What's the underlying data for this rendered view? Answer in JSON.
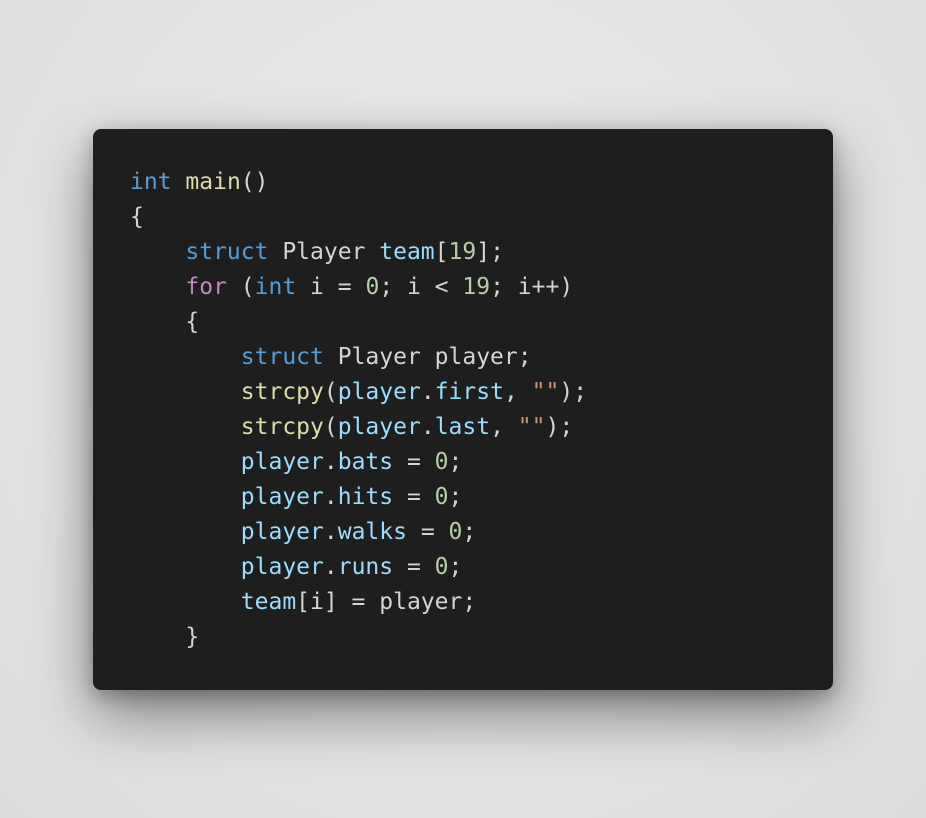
{
  "theme": {
    "background": "#e4e4e4",
    "editor_background": "#1e1e1e",
    "colors": {
      "default": "#d4d4d4",
      "keyword": "#569cd6",
      "control": "#c586c0",
      "function": "#dcdcaa",
      "variable": "#9cdcfe",
      "number": "#b5cea8",
      "string": "#ce9178"
    }
  },
  "code": {
    "language": "c",
    "lines": [
      [
        {
          "t": "int",
          "c": "keyword"
        },
        {
          "t": " ",
          "c": "default"
        },
        {
          "t": "main",
          "c": "function"
        },
        {
          "t": "()",
          "c": "default"
        }
      ],
      [
        {
          "t": "{",
          "c": "default"
        }
      ],
      [
        {
          "t": "    ",
          "c": "default"
        },
        {
          "t": "struct",
          "c": "keyword"
        },
        {
          "t": " Player ",
          "c": "default"
        },
        {
          "t": "team",
          "c": "variable"
        },
        {
          "t": "[",
          "c": "default"
        },
        {
          "t": "19",
          "c": "number"
        },
        {
          "t": "];",
          "c": "default"
        }
      ],
      [
        {
          "t": "    ",
          "c": "default"
        },
        {
          "t": "for",
          "c": "control"
        },
        {
          "t": " (",
          "c": "default"
        },
        {
          "t": "int",
          "c": "keyword"
        },
        {
          "t": " i = ",
          "c": "default"
        },
        {
          "t": "0",
          "c": "number"
        },
        {
          "t": "; i < ",
          "c": "default"
        },
        {
          "t": "19",
          "c": "number"
        },
        {
          "t": "; i++)",
          "c": "default"
        }
      ],
      [
        {
          "t": "    {",
          "c": "default"
        }
      ],
      [
        {
          "t": "        ",
          "c": "default"
        },
        {
          "t": "struct",
          "c": "keyword"
        },
        {
          "t": " Player player;",
          "c": "default"
        }
      ],
      [
        {
          "t": "        ",
          "c": "default"
        },
        {
          "t": "strcpy",
          "c": "function"
        },
        {
          "t": "(",
          "c": "default"
        },
        {
          "t": "player",
          "c": "variable"
        },
        {
          "t": ".",
          "c": "default"
        },
        {
          "t": "first",
          "c": "variable"
        },
        {
          "t": ", ",
          "c": "default"
        },
        {
          "t": "\"\"",
          "c": "string"
        },
        {
          "t": ");",
          "c": "default"
        }
      ],
      [
        {
          "t": "        ",
          "c": "default"
        },
        {
          "t": "strcpy",
          "c": "function"
        },
        {
          "t": "(",
          "c": "default"
        },
        {
          "t": "player",
          "c": "variable"
        },
        {
          "t": ".",
          "c": "default"
        },
        {
          "t": "last",
          "c": "variable"
        },
        {
          "t": ", ",
          "c": "default"
        },
        {
          "t": "\"\"",
          "c": "string"
        },
        {
          "t": ");",
          "c": "default"
        }
      ],
      [
        {
          "t": "        ",
          "c": "default"
        },
        {
          "t": "player",
          "c": "variable"
        },
        {
          "t": ".",
          "c": "default"
        },
        {
          "t": "bats",
          "c": "variable"
        },
        {
          "t": " = ",
          "c": "default"
        },
        {
          "t": "0",
          "c": "number"
        },
        {
          "t": ";",
          "c": "default"
        }
      ],
      [
        {
          "t": "        ",
          "c": "default"
        },
        {
          "t": "player",
          "c": "variable"
        },
        {
          "t": ".",
          "c": "default"
        },
        {
          "t": "hits",
          "c": "variable"
        },
        {
          "t": " = ",
          "c": "default"
        },
        {
          "t": "0",
          "c": "number"
        },
        {
          "t": ";",
          "c": "default"
        }
      ],
      [
        {
          "t": "        ",
          "c": "default"
        },
        {
          "t": "player",
          "c": "variable"
        },
        {
          "t": ".",
          "c": "default"
        },
        {
          "t": "walks",
          "c": "variable"
        },
        {
          "t": " = ",
          "c": "default"
        },
        {
          "t": "0",
          "c": "number"
        },
        {
          "t": ";",
          "c": "default"
        }
      ],
      [
        {
          "t": "        ",
          "c": "default"
        },
        {
          "t": "player",
          "c": "variable"
        },
        {
          "t": ".",
          "c": "default"
        },
        {
          "t": "runs",
          "c": "variable"
        },
        {
          "t": " = ",
          "c": "default"
        },
        {
          "t": "0",
          "c": "number"
        },
        {
          "t": ";",
          "c": "default"
        }
      ],
      [
        {
          "t": "        ",
          "c": "default"
        },
        {
          "t": "team",
          "c": "variable"
        },
        {
          "t": "[i] = player;",
          "c": "default"
        }
      ],
      [
        {
          "t": "    }",
          "c": "default"
        }
      ]
    ]
  }
}
